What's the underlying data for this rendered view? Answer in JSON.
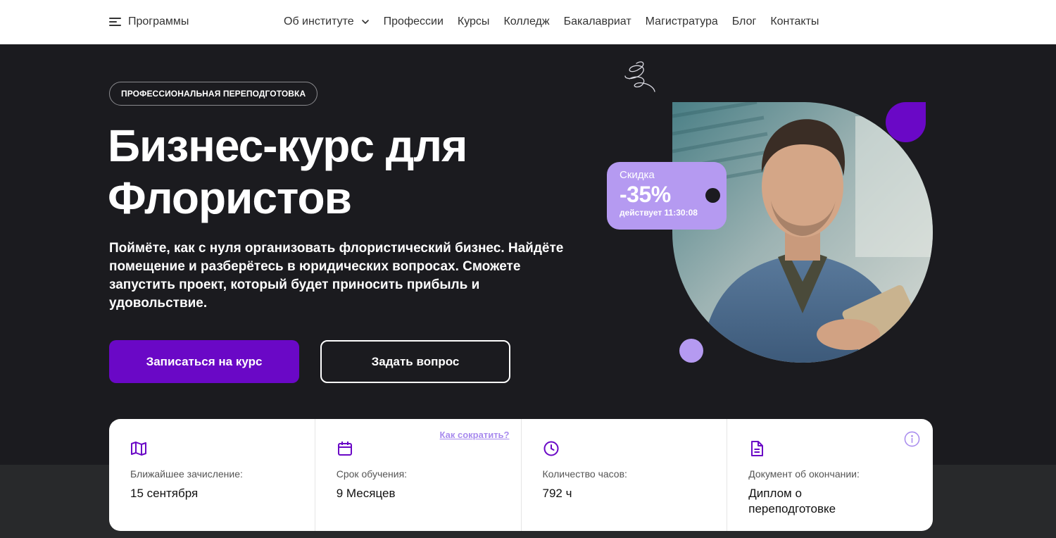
{
  "header": {
    "programs_label": "Программы",
    "nav": [
      {
        "label": "Об институте",
        "has_dropdown": true
      },
      {
        "label": "Профессии"
      },
      {
        "label": "Курсы"
      },
      {
        "label": "Колледж"
      },
      {
        "label": "Бакалавриат"
      },
      {
        "label": "Магистратура"
      },
      {
        "label": "Блог"
      },
      {
        "label": "Контакты"
      }
    ]
  },
  "hero": {
    "badge": "ПРОФЕССИОНАЛЬНАЯ ПЕРЕПОДГОТОВКА",
    "title": "Бизнес-курс для Флористов",
    "description": "Поймёте, как с нуля организовать флористический бизнес. Найдёте помещение и разберётесь в юридических вопросах. Сможете запустить проект, который будет приносить прибыль и удовольствие.",
    "primary_button": "Записаться на курс",
    "secondary_button": "Задать вопрос"
  },
  "discount": {
    "label": "Скидка",
    "value": "-35%",
    "timer": "действует 11:30:08"
  },
  "info": {
    "shorten_link": "Как сократить?",
    "items": [
      {
        "icon": "map-icon",
        "label": "Ближайшее зачисление:",
        "value": "15 сентября"
      },
      {
        "icon": "calendar-icon",
        "label": "Срок обучения:",
        "value": "9 Месяцев"
      },
      {
        "icon": "clock-icon",
        "label": "Количество часов:",
        "value": "792 ч"
      },
      {
        "icon": "document-icon",
        "label": "Документ об окончании:",
        "value": "Диплом о переподготовке"
      }
    ]
  },
  "colors": {
    "accent": "#6a08c6",
    "lilac": "#b59af1",
    "background_dark": "#1b1b1f",
    "background_lower": "#28292b"
  }
}
